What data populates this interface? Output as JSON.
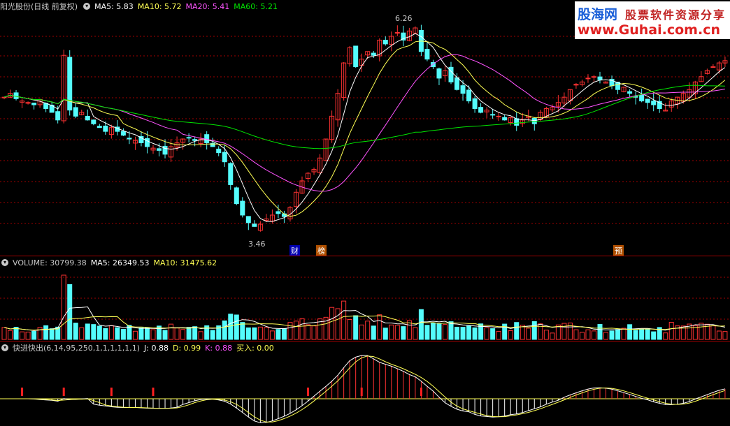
{
  "price_header": {
    "title": "阳光股份(日线 前复权)",
    "ma5": "MA5: 5.83",
    "ma10": "MA10: 5.72",
    "ma20": "MA20: 5.41",
    "ma60": "MA60: 5.21",
    "high_label": "6.26",
    "low_label": "3.46"
  },
  "event_tags": [
    "财",
    "榜",
    "预"
  ],
  "logo": {
    "line1_a": "股海网",
    "line1_b": "股票软件资源分享",
    "line2": "www.Guhai.com.cn"
  },
  "volume_header": {
    "title": "VOLUME: 30799.38",
    "ma5": "MA5: 26349.53",
    "ma10": "MA10: 31475.62"
  },
  "indicator_header": {
    "title": "快进快出(6,14,95,250,1,1,1,1,1,1)",
    "j": "J: 0.88",
    "d": "D: 0.99",
    "k": "K: 0.88",
    "buy": "买入: 0.00"
  },
  "colors": {
    "up": "#ff3232",
    "down": "#54fcfc",
    "ma5": "#ffffff",
    "ma10": "#ffff54",
    "ma20": "#ff54ff",
    "ma60": "#00e600",
    "grid": "#a00000"
  },
  "chart_data": {
    "type": "candlestick",
    "y_high": 6.26,
    "y_low": 3.46,
    "closes": [
      5.35,
      5.4,
      5.33,
      5.3,
      5.28,
      5.25,
      5.32,
      5.2,
      5.15,
      5.05,
      5.9,
      5.18,
      5.1,
      5.15,
      5.05,
      5.0,
      4.95,
      4.9,
      4.95,
      4.9,
      4.85,
      4.8,
      4.78,
      4.75,
      4.7,
      4.68,
      4.65,
      4.6,
      4.7,
      4.75,
      4.8,
      4.82,
      4.78,
      4.8,
      4.75,
      4.7,
      4.62,
      4.5,
      4.2,
      3.95,
      3.8,
      3.7,
      3.65,
      3.68,
      3.75,
      3.8,
      3.82,
      3.78,
      3.9,
      4.1,
      4.25,
      4.35,
      4.4,
      4.55,
      4.8,
      5.1,
      5.4,
      5.8,
      6.0,
      5.75,
      5.85,
      5.95,
      5.9,
      6.1,
      6.05,
      6.15,
      6.2,
      6.1,
      6.22,
      6.26,
      5.95,
      5.85,
      5.75,
      5.6,
      5.7,
      5.55,
      5.45,
      5.4,
      5.3,
      5.2,
      5.15,
      5.18,
      5.12,
      5.1,
      5.05,
      5.08,
      4.98,
      5.05,
      5.1,
      5.0,
      5.15,
      5.2,
      5.22,
      5.28,
      5.35,
      5.45,
      5.52,
      5.55,
      5.6,
      5.62,
      5.58,
      5.55,
      5.5,
      5.45,
      5.48,
      5.4,
      5.35,
      5.3,
      5.28,
      5.25,
      5.2,
      5.18,
      5.3,
      5.35,
      5.4,
      5.45,
      5.55,
      5.62,
      5.7,
      5.75,
      5.8,
      5.83
    ]
  }
}
